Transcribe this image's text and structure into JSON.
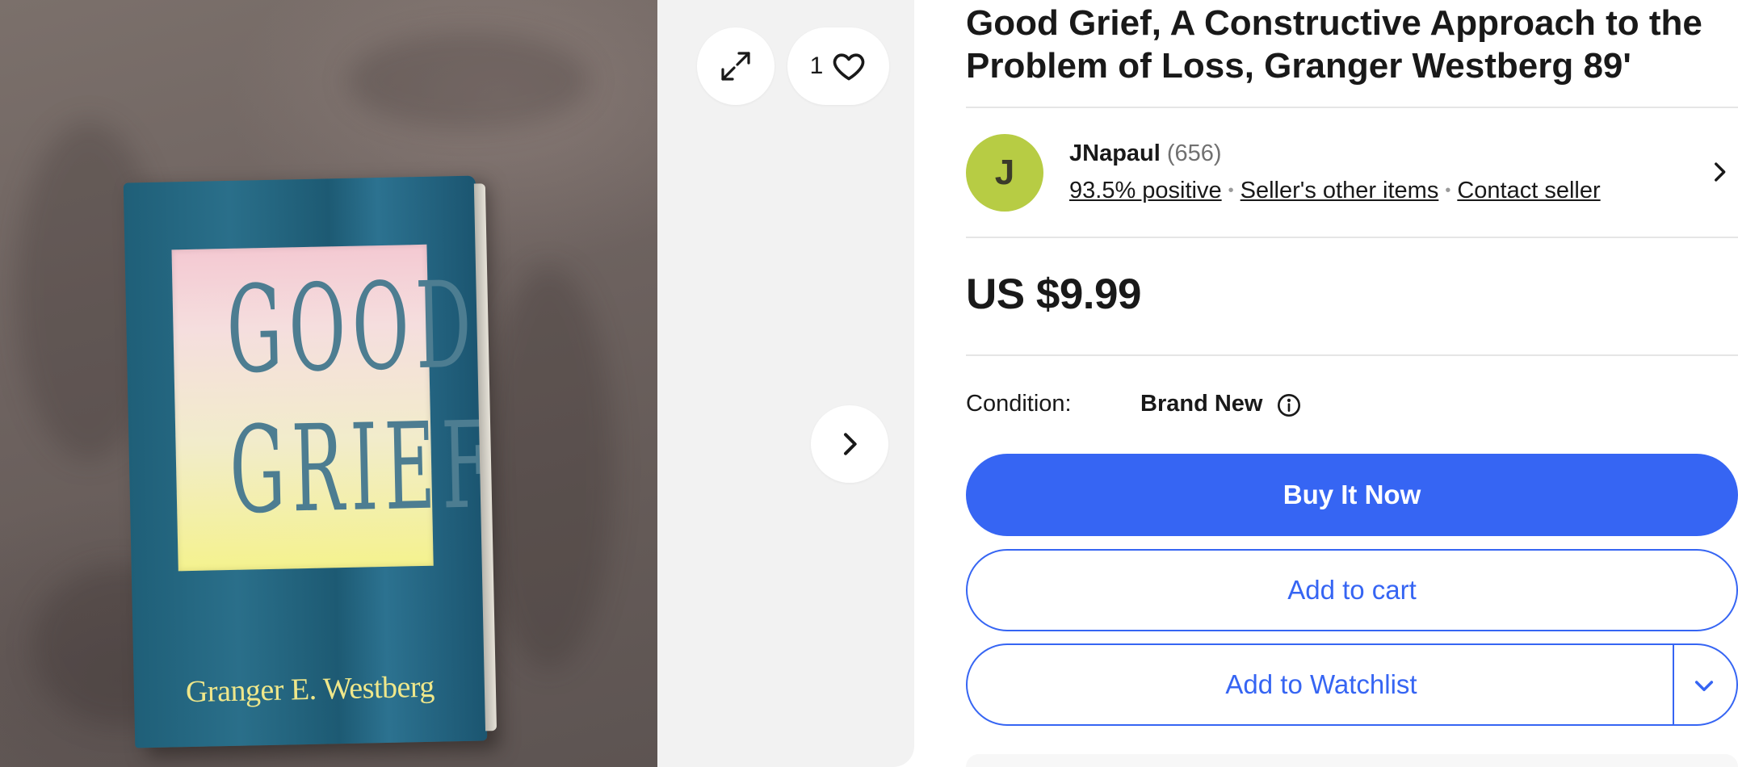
{
  "gallery": {
    "book_cover": {
      "title_line1": "GOOD",
      "title_line2": "GRIEF",
      "author": "Granger E. Westberg"
    },
    "expand_icon": "expand-icon",
    "watch_count": "1",
    "heart_icon": "heart-icon",
    "next_icon": "chevron-right-icon"
  },
  "listing": {
    "title": "Good Grief, A Constructive Approach to the Problem of Loss, Granger Westberg 89'",
    "seller": {
      "avatar_letter": "J",
      "name": "JNapaul",
      "feedback_count": "(656)",
      "positive": "93.5% positive",
      "other_items": "Seller's other items",
      "contact": "Contact seller"
    },
    "price": "US $9.99",
    "condition_label": "Condition:",
    "condition_value": "Brand New",
    "buttons": {
      "buy_now": "Buy It Now",
      "add_to_cart": "Add to cart",
      "add_to_watchlist": "Add to Watchlist"
    }
  },
  "colors": {
    "primary_blue": "#3665f3",
    "avatar_green": "#b7cc44",
    "text": "#191919",
    "gallery_bg": "#f2f2f2"
  }
}
